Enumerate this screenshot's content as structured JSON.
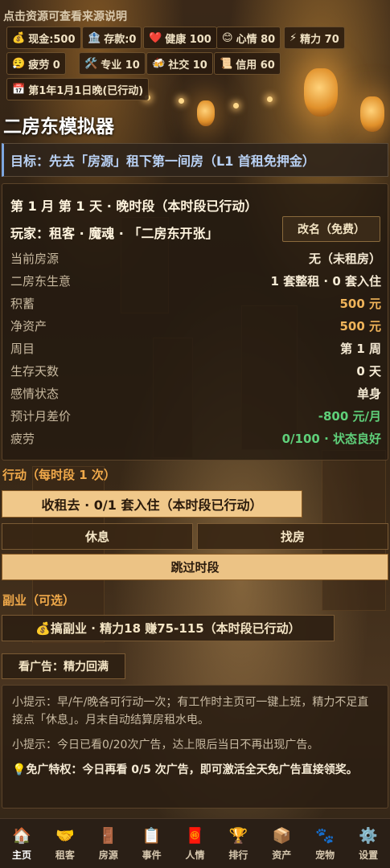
{
  "top_hint": "点击资源可查看来源说明",
  "stats": [
    {
      "icon": "💰",
      "icon_name": "money-bag-icon",
      "label": "现金:500"
    },
    {
      "icon": "🏦",
      "icon_name": "bank-icon",
      "label": "存款:0"
    },
    {
      "icon": "❤️",
      "icon_name": "heart-icon",
      "label": "健康 100"
    },
    {
      "icon": "😊",
      "icon_name": "smile-icon",
      "label": "心情 80"
    },
    {
      "icon": "⚡",
      "icon_name": "lightning-icon",
      "label": "精力 70"
    },
    {
      "icon": "😮‍💨",
      "icon_name": "tired-face-icon",
      "label": "疲劳 0"
    },
    {
      "icon": "🛠️",
      "icon_name": "tools-icon",
      "label": "专业 10"
    },
    {
      "icon": "🍻",
      "icon_name": "beer-icon",
      "label": "社交 10"
    },
    {
      "icon": "📜",
      "icon_name": "scroll-icon",
      "label": "信用 60"
    },
    {
      "icon": "📅",
      "icon_name": "calendar-icon",
      "label": "第1年1月1日晚(已行动)"
    }
  ],
  "app_title": "二房东模拟器",
  "goal": "目标：先去「房源」租下第一间房（L1 首租免押金）",
  "status_panel": {
    "heading": "第 1 月 第 1 天 · 晚时段（本时段已行动）",
    "player": "玩家：租客 · 魔魂 · 「二房东开张」",
    "rename_label": "改名（免费）",
    "rows": [
      {
        "label": "当前房源",
        "value": "无（未租房）",
        "tone": "normal"
      },
      {
        "label": "二房东生意",
        "value": "1 套整租 · 0 套入住",
        "tone": "normal"
      },
      {
        "label": "积蓄",
        "value": "500 元",
        "tone": "gold"
      },
      {
        "label": "净资产",
        "value": "500 元",
        "tone": "gold"
      },
      {
        "label": "周目",
        "value": "第 1 周",
        "tone": "normal"
      },
      {
        "label": "生存天数",
        "value": "0 天",
        "tone": "normal"
      },
      {
        "label": "感情状态",
        "value": "单身",
        "tone": "normal"
      },
      {
        "label": "预计月差价",
        "value": "-800 元/月",
        "tone": "green"
      },
      {
        "label": "疲劳",
        "value": "0/100 · 状态良好",
        "tone": "green"
      }
    ]
  },
  "actions": {
    "section_label": "行动（每时段 1 次）",
    "rent_label": "收租去 · 0/1 套入住（本时段已行动）",
    "rest_label": "休息",
    "find_house_label": "找房",
    "skip_label": "跳过时段"
  },
  "side_jobs": {
    "section_label": "副业（可选）",
    "side_job_label": "💰搞副业 · 精力18 赚75-115（本时段已行动）",
    "ad_label": "看广告：精力回满"
  },
  "tips": {
    "tip1": "小提示：早/午/晚各可行动一次；有工作时主页可一键上班，精力不足直接点「休息」。月末自动结算房租水电。",
    "tip2": "小提示：今日已看0/20次广告，达上限后当日不再出现广告。",
    "tip3": "💡免广特权：今日再看 0/5 次广告，即可激活全天免广告直接领奖。"
  },
  "nav": [
    {
      "icon": "🏠",
      "icon_name": "home-icon",
      "label": "主页",
      "active": true
    },
    {
      "icon": "🤝",
      "icon_name": "handshake-icon",
      "label": "租客"
    },
    {
      "icon": "🚪",
      "icon_name": "door-icon",
      "label": "房源"
    },
    {
      "icon": "📋",
      "icon_name": "clipboard-icon",
      "label": "事件"
    },
    {
      "icon": "🧧",
      "icon_name": "red-envelope-icon",
      "label": "人情"
    },
    {
      "icon": "🏆",
      "icon_name": "trophy-icon",
      "label": "排行"
    },
    {
      "icon": "📦",
      "icon_name": "package-icon",
      "label": "资产"
    },
    {
      "icon": "🐾",
      "icon_name": "paw-icon",
      "label": "宠物"
    },
    {
      "icon": "⚙️",
      "icon_name": "gear-icon",
      "label": "设置"
    }
  ]
}
